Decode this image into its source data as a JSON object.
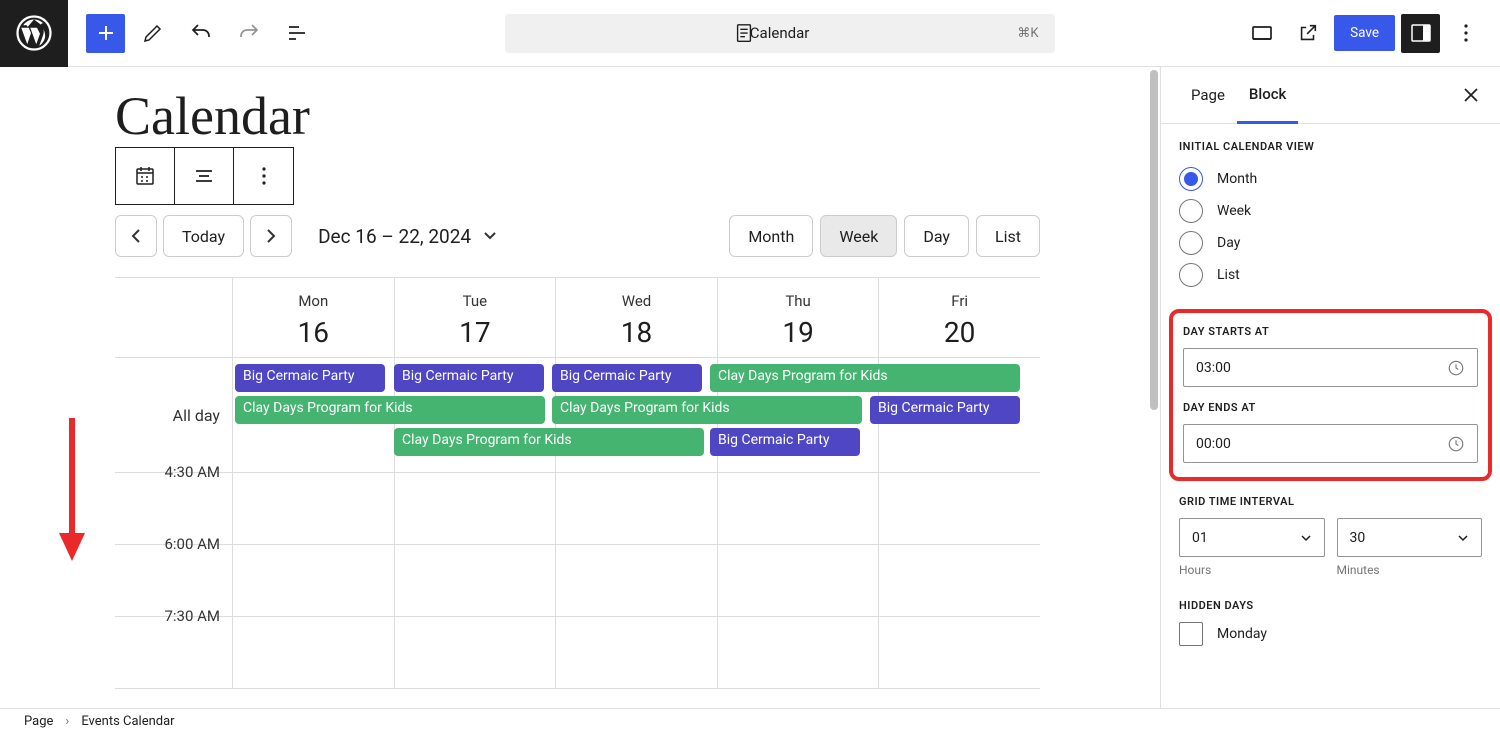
{
  "topbar": {
    "doc_title": "Calendar",
    "kbd_hint": "⌘K",
    "save_label": "Save"
  },
  "page": {
    "heading": "Calendar"
  },
  "calendar": {
    "today_label": "Today",
    "date_range": "Dec 16 – 22, 2024",
    "views": {
      "month": "Month",
      "week": "Week",
      "day": "Day",
      "list": "List"
    },
    "all_day_label": "All day",
    "days": [
      {
        "dow": "Mon",
        "num": "16"
      },
      {
        "dow": "Tue",
        "num": "17"
      },
      {
        "dow": "Wed",
        "num": "18"
      },
      {
        "dow": "Thu",
        "num": "19"
      },
      {
        "dow": "Fri",
        "num": "20"
      }
    ],
    "events": {
      "bcp": "Big Cermaic Party",
      "clay": "Clay Days Program for Kids"
    },
    "time_rows": [
      "4:30 AM",
      "6:00 AM",
      "7:30 AM"
    ]
  },
  "sidebar": {
    "tabs": {
      "page": "Page",
      "block": "Block"
    },
    "sections": {
      "initial_view": "INITIAL CALENDAR VIEW",
      "day_starts": "DAY STARTS AT",
      "day_ends": "DAY ENDS AT",
      "grid_interval": "GRID TIME INTERVAL",
      "hidden_days": "HIDDEN DAYS"
    },
    "initial_view_options": {
      "month": "Month",
      "week": "Week",
      "day": "Day",
      "list": "List"
    },
    "day_starts_value": "03:00",
    "day_ends_value": "00:00",
    "interval_hours": "01",
    "interval_minutes": "30",
    "interval_labels": {
      "hours": "Hours",
      "minutes": "Minutes"
    },
    "hidden_day_monday": "Monday"
  },
  "footer": {
    "page": "Page",
    "crumb": "Events Calendar"
  }
}
